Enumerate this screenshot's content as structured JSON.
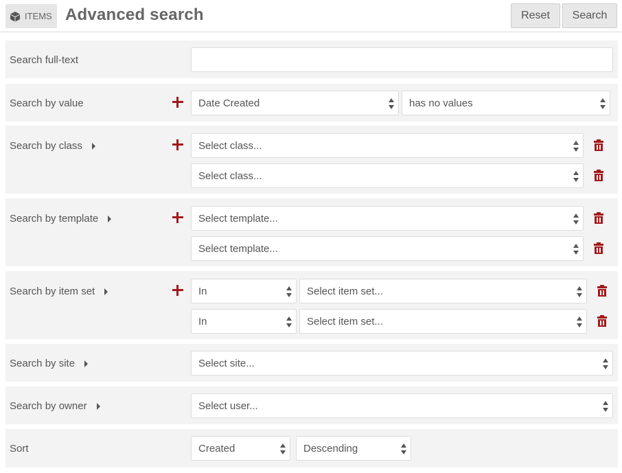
{
  "header": {
    "badge_label": "ITEMS",
    "badge_icon": "cube-icon",
    "title": "Advanced search",
    "reset_label": "Reset",
    "search_label": "Search"
  },
  "fulltext": {
    "label": "Search full-text",
    "value": ""
  },
  "by_value": {
    "label": "Search by value",
    "property": "Date Created",
    "operator": "has no values"
  },
  "by_class": {
    "label": "Search by class",
    "rows": [
      "Select class...",
      "Select class..."
    ]
  },
  "by_template": {
    "label": "Search by template",
    "rows": [
      "Select template...",
      "Select template..."
    ]
  },
  "by_item_set": {
    "label": "Search by item set",
    "rows": [
      {
        "mode": "In",
        "value": "Select item set..."
      },
      {
        "mode": "In",
        "value": "Select item set..."
      }
    ]
  },
  "by_site": {
    "label": "Search by site",
    "value": "Select site..."
  },
  "by_owner": {
    "label": "Search by owner",
    "value": "Select user..."
  },
  "sort": {
    "label": "Sort",
    "by": "Created",
    "order": "Descending"
  },
  "colors": {
    "accent_red": "#a3191b",
    "row_bg": "#f3f3f3",
    "text": "#555555"
  }
}
